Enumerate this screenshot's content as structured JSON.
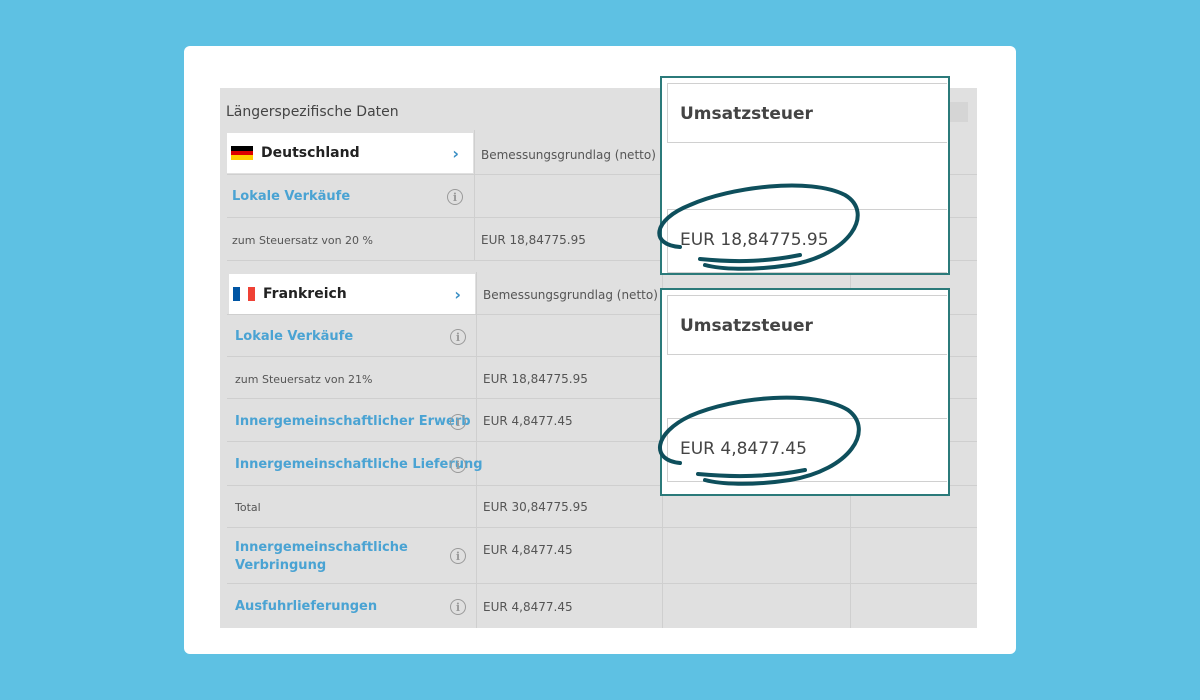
{
  "panel": {
    "title": "Längerspezifische Daten"
  },
  "germany": {
    "country": "Deutschland",
    "column_header": "Bemessungsgrundlag (netto)",
    "local_sales_label": "Lokale Verkäufe",
    "tax_rate_label": "zum Steuersatz von 20 %",
    "tax_rate_value": "EUR 18,84775.95"
  },
  "france": {
    "country": "Frankreich",
    "column_header": "Bemessungsgrundlag (netto)",
    "local_sales_label": "Lokale Verkäufe",
    "tax_rate_label": "zum Steuersatz von 21%",
    "tax_rate_value": "EUR 18,84775.95",
    "acquisition_label": "Innergemeinschaftlicher Erwerb",
    "acquisition_value": "EUR 4,8477.45",
    "delivery_label": "Innergemeinschaftliche Lieferung",
    "total_label": "Total",
    "total_value": "EUR 30,84775.95",
    "transfer_label": "Innergemeinschaftliche Verbringung",
    "transfer_value": "EUR 4,8477.45",
    "export_label": "Ausfuhrlieferungen",
    "export_value": "EUR 4,8477.45"
  },
  "popout_de": {
    "header": "Umsatzsteuer",
    "value": "EUR 18,84775.95"
  },
  "popout_fr": {
    "header": "Umsatzsteuer",
    "value": "EUR 4,8477.45"
  },
  "icons": {
    "info": "info-icon",
    "chevron": "chevron-right-icon"
  },
  "colors": {
    "background": "#5ec1e3",
    "accent_blue": "#4aa3d3",
    "highlight": "#0e4f5c",
    "popout_border": "#2b7a7a"
  }
}
